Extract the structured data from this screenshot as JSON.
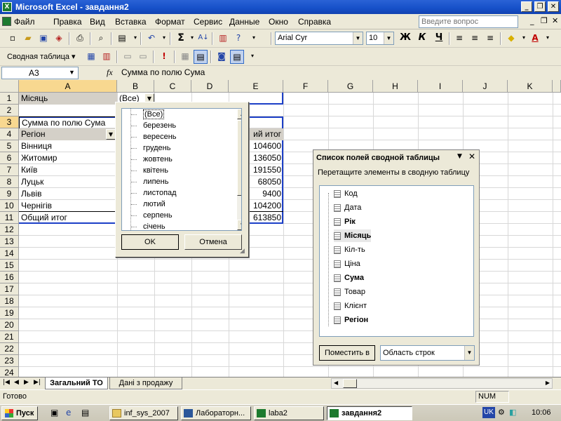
{
  "window": {
    "title": "Microsoft Excel - завдання2",
    "controls": [
      "_",
      "❐",
      "✕"
    ]
  },
  "menu": {
    "items": [
      "Файл",
      "Правка",
      "Вид",
      "Вставка",
      "Формат",
      "Сервис",
      "Данные",
      "Окно",
      "Справка"
    ],
    "help_placeholder": "Введите вопрос",
    "doc_controls": [
      "_",
      "❐",
      "✕"
    ]
  },
  "toolbar": {
    "font_name": "Arial Cyr",
    "font_size": "10",
    "bold": "Ж",
    "italic": "К",
    "underline": "Ч",
    "sum": "Σ"
  },
  "pivot_toolbar": {
    "label": "Сводная таблица ▾"
  },
  "formula_bar": {
    "name_box": "A3",
    "fx": "fx",
    "content": "Сумма по полю Сума"
  },
  "columns": [
    "A",
    "B",
    "C",
    "D",
    "E",
    "F",
    "G",
    "H",
    "I",
    "J",
    "K"
  ],
  "rows": [
    "1",
    "2",
    "3",
    "4",
    "5",
    "6",
    "7",
    "8",
    "9",
    "10",
    "11",
    "12",
    "13",
    "14",
    "15",
    "16",
    "17",
    "18",
    "19",
    "20",
    "21",
    "22",
    "23",
    "24"
  ],
  "sheet": {
    "a1": "Місяць",
    "b1": "(Все)",
    "a3": "Сумма по полю Сума",
    "a4": "Регіон",
    "e4": "ий итог",
    "regions": [
      "Вінниця",
      "Житомир",
      "Київ",
      "Луцьк",
      "Львів",
      "Чернігів"
    ],
    "totals": [
      "104600",
      "136050",
      "191550",
      "68050",
      "9400",
      "104200"
    ],
    "grand_label": "Общий итог",
    "grand_total": "613850"
  },
  "dropdown": {
    "items": [
      "(Все)",
      "березень",
      "вересень",
      "грудень",
      "жовтень",
      "квітень",
      "липень",
      "листопад",
      "лютий",
      "серпень",
      "січень"
    ],
    "ok": "OK",
    "cancel": "Отмена"
  },
  "field_list": {
    "title": "Список полей сводной таблицы",
    "subtitle": "Перетащите элементы в сводную таблицу",
    "fields": [
      {
        "label": "Код",
        "bold": false
      },
      {
        "label": "Дата",
        "bold": false
      },
      {
        "label": "Рік",
        "bold": true
      },
      {
        "label": "Місяць",
        "bold": true
      },
      {
        "label": "Кіл-ть",
        "bold": false
      },
      {
        "label": "Ціна",
        "bold": false
      },
      {
        "label": "Сума",
        "bold": true
      },
      {
        "label": "Товар",
        "bold": false
      },
      {
        "label": "Клієнт",
        "bold": false
      },
      {
        "label": "Регіон",
        "bold": true
      }
    ],
    "place_button": "Поместить в",
    "area_select": "Область строк"
  },
  "tabs": [
    "Загальний ТО",
    "Дані з продажу"
  ],
  "status": {
    "text": "Готово",
    "num": "NUM"
  },
  "taskbar": {
    "start": "Пуск",
    "tasks": [
      "inf_sys_2007",
      "Лабораторн...",
      "laba2",
      "завдання2"
    ],
    "lang": "UK",
    "clock": "10:06"
  },
  "colors": {
    "titlebar": "#1650c8",
    "pivot_border": "#1c3fc7",
    "selection": "#1c3fc7"
  }
}
